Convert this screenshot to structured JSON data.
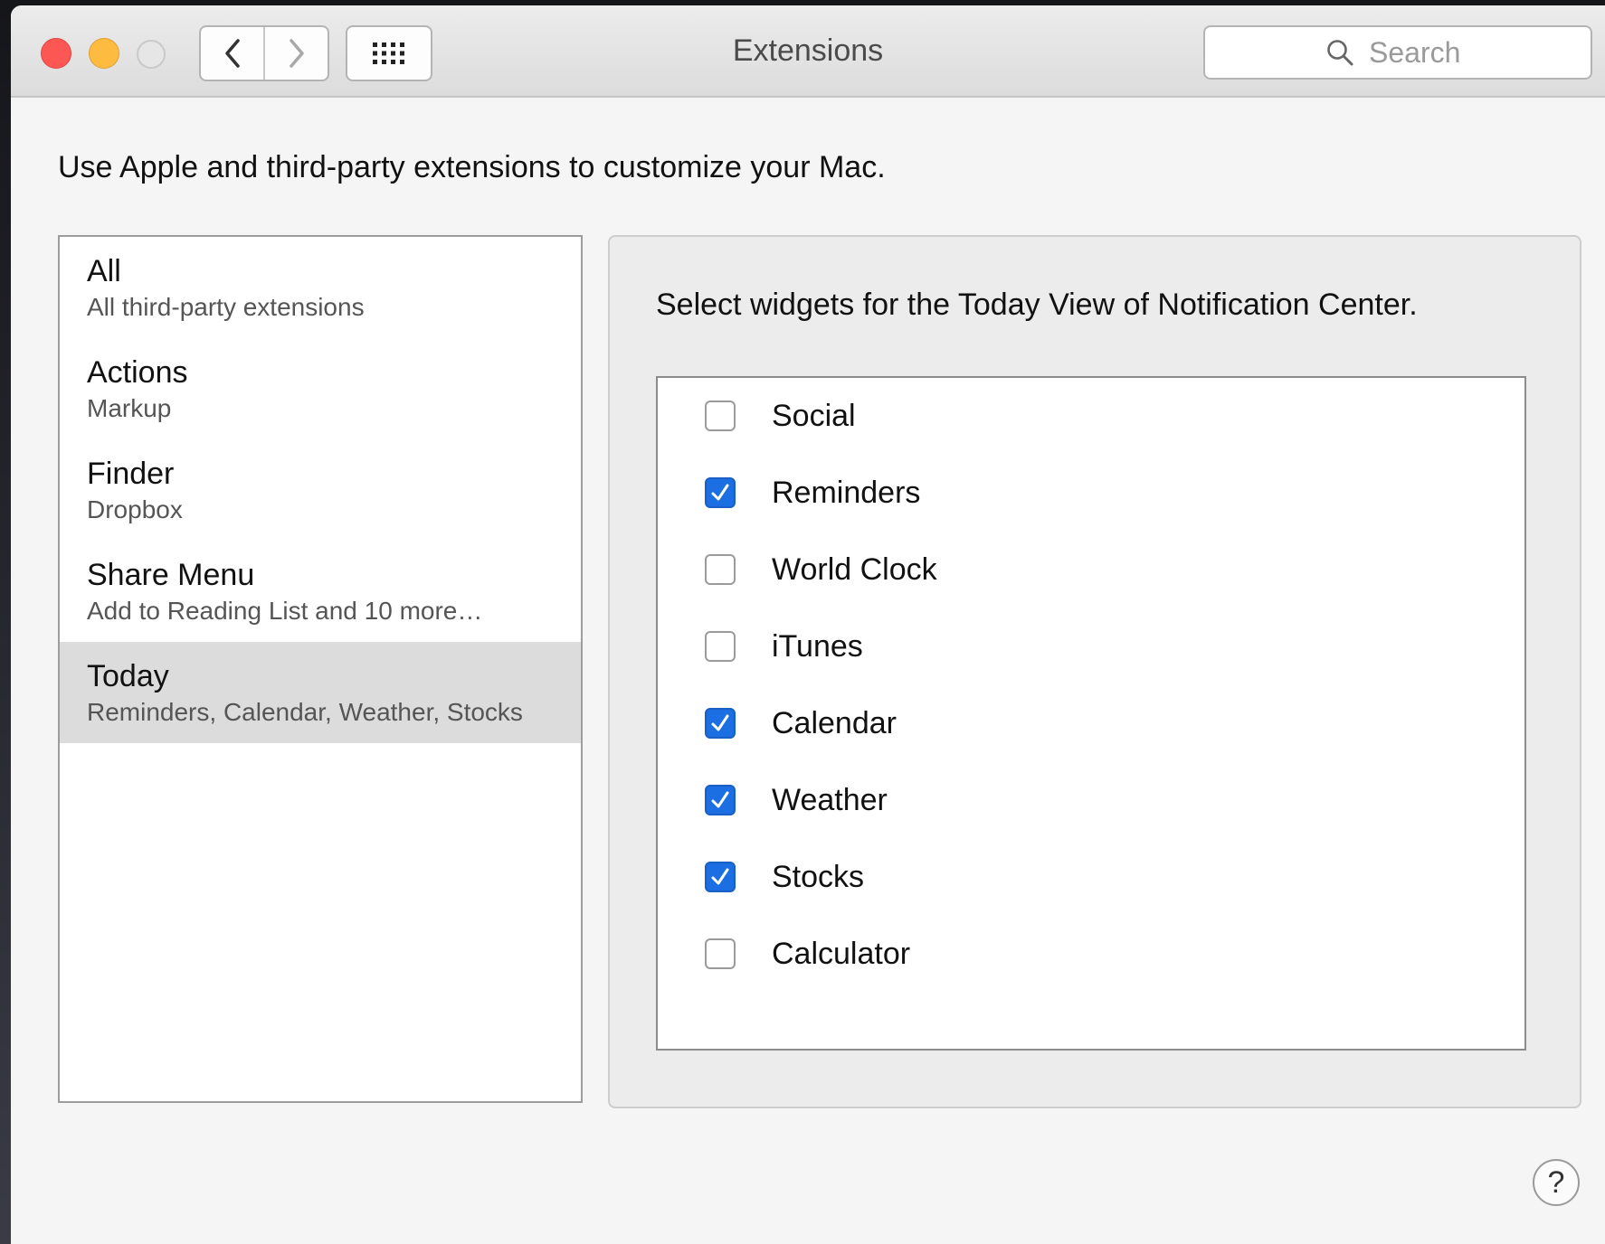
{
  "window": {
    "title": "Extensions"
  },
  "toolbar": {
    "back_icon": "chevron-left-icon",
    "forward_icon": "chevron-right-icon",
    "grid_icon": "show-all-grid-icon",
    "search": {
      "placeholder": "Search",
      "value": ""
    }
  },
  "description": "Use Apple and third-party extensions to customize your Mac.",
  "categories": [
    {
      "title": "All",
      "subtitle": "All third-party extensions",
      "selected": false
    },
    {
      "title": "Actions",
      "subtitle": "Markup",
      "selected": false
    },
    {
      "title": "Finder",
      "subtitle": "Dropbox",
      "selected": false
    },
    {
      "title": "Share Menu",
      "subtitle": "Add to Reading List and 10 more…",
      "selected": false
    },
    {
      "title": "Today",
      "subtitle": "Reminders, Calendar, Weather, Stocks",
      "selected": true
    }
  ],
  "detail": {
    "heading": "Select widgets for the Today View of Notification Center.",
    "widgets": [
      {
        "label": "Social",
        "checked": false
      },
      {
        "label": "Reminders",
        "checked": true
      },
      {
        "label": "World Clock",
        "checked": false
      },
      {
        "label": "iTunes",
        "checked": false
      },
      {
        "label": "Calendar",
        "checked": true
      },
      {
        "label": "Weather",
        "checked": true
      },
      {
        "label": "Stocks",
        "checked": true
      },
      {
        "label": "Calculator",
        "checked": false
      }
    ]
  },
  "help": {
    "label": "?"
  },
  "colors": {
    "close": "#fc5753",
    "minimize": "#fdbc40",
    "checkbox_checked": "#1c6fe2",
    "selection": "#dcdcdc"
  }
}
